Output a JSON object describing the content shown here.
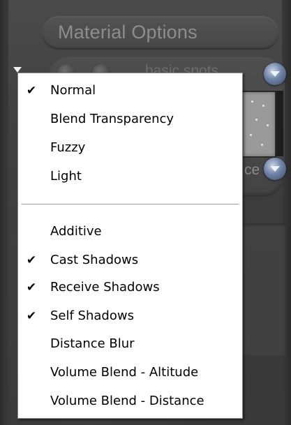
{
  "panel": {
    "title": "Material Options",
    "background_label": "basic spots",
    "background_label_2": "ce"
  },
  "menu": {
    "group1": [
      {
        "label": "Normal",
        "checked": true
      },
      {
        "label": "Blend Transparency",
        "checked": false
      },
      {
        "label": "Fuzzy",
        "checked": false
      },
      {
        "label": "Light",
        "checked": false
      }
    ],
    "group2": [
      {
        "label": "Additive",
        "checked": false
      },
      {
        "label": "Cast Shadows",
        "checked": true
      },
      {
        "label": "Receive Shadows",
        "checked": true
      },
      {
        "label": "Self Shadows",
        "checked": true
      },
      {
        "label": "Distance Blur",
        "checked": false
      },
      {
        "label": "Volume Blend - Altitude",
        "checked": false
      },
      {
        "label": "Volume Blend - Distance",
        "checked": false
      }
    ],
    "check_glyph": "✔"
  },
  "colors": {
    "menu_bg": "#ffffff",
    "panel_bg": "#3f3f3f",
    "accent_button": "#6f83a6"
  }
}
